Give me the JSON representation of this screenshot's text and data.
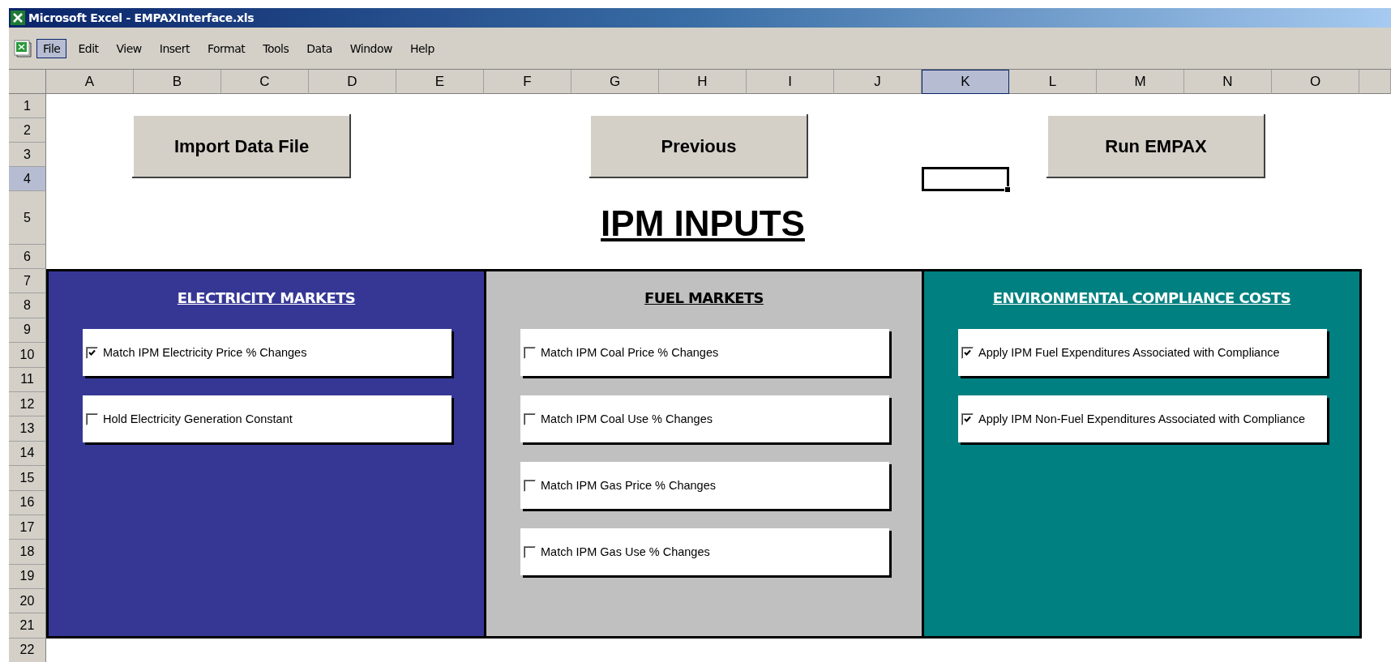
{
  "window": {
    "title": "Microsoft Excel - EMPAXInterface.xls"
  },
  "menu": [
    {
      "label": "File",
      "selected": true
    },
    {
      "label": "Edit",
      "selected": false
    },
    {
      "label": "View",
      "selected": false
    },
    {
      "label": "Insert",
      "selected": false
    },
    {
      "label": "Format",
      "selected": false
    },
    {
      "label": "Tools",
      "selected": false
    },
    {
      "label": "Data",
      "selected": false
    },
    {
      "label": "Window",
      "selected": false
    },
    {
      "label": "Help",
      "selected": false
    }
  ],
  "columns": [
    {
      "label": "A",
      "selected": false
    },
    {
      "label": "B",
      "selected": false
    },
    {
      "label": "C",
      "selected": false
    },
    {
      "label": "D",
      "selected": false
    },
    {
      "label": "E",
      "selected": false
    },
    {
      "label": "F",
      "selected": false
    },
    {
      "label": "G",
      "selected": false
    },
    {
      "label": "H",
      "selected": false
    },
    {
      "label": "I",
      "selected": false
    },
    {
      "label": "J",
      "selected": false
    },
    {
      "label": "K",
      "selected": true
    },
    {
      "label": "L",
      "selected": false
    },
    {
      "label": "M",
      "selected": false
    },
    {
      "label": "N",
      "selected": false
    },
    {
      "label": "O",
      "selected": false
    }
  ],
  "rows": [
    {
      "label": "1",
      "selected": false
    },
    {
      "label": "2",
      "selected": false
    },
    {
      "label": "3",
      "selected": false
    },
    {
      "label": "4",
      "selected": true
    },
    {
      "label": "5",
      "selected": false
    },
    {
      "label": "6",
      "selected": false
    },
    {
      "label": "7",
      "selected": false
    },
    {
      "label": "8",
      "selected": false
    },
    {
      "label": "9",
      "selected": false
    },
    {
      "label": "10",
      "selected": false
    },
    {
      "label": "11",
      "selected": false
    },
    {
      "label": "12",
      "selected": false
    },
    {
      "label": "13",
      "selected": false
    },
    {
      "label": "14",
      "selected": false
    },
    {
      "label": "15",
      "selected": false
    },
    {
      "label": "16",
      "selected": false
    },
    {
      "label": "17",
      "selected": false
    },
    {
      "label": "18",
      "selected": false
    },
    {
      "label": "19",
      "selected": false
    },
    {
      "label": "20",
      "selected": false
    },
    {
      "label": "21",
      "selected": false
    },
    {
      "label": "22",
      "selected": false
    }
  ],
  "buttons": [
    "Import Data File",
    "Previous",
    "Run EMPAX"
  ],
  "heading": "IPM INPUTS",
  "panels": [
    {
      "title": "ELECTRICITY MARKETS",
      "color": "#363795",
      "options": [
        {
          "label": "Match IPM Electricity Price % Changes",
          "checked": true
        },
        {
          "label": "Hold Electricity Generation Constant",
          "checked": false
        }
      ]
    },
    {
      "title": "FUEL MARKETS",
      "color": "#c0c0c0",
      "options": [
        {
          "label": "Match IPM Coal Price % Changes",
          "checked": false
        },
        {
          "label": "Match IPM Coal Use % Changes",
          "checked": false
        },
        {
          "label": "Match IPM Gas Price % Changes",
          "checked": false
        },
        {
          "label": "Match IPM Gas Use % Changes",
          "checked": false
        }
      ]
    },
    {
      "title": "ENVIRONMENTAL COMPLIANCE COSTS",
      "color": "#008080",
      "options": [
        {
          "label": "Apply IPM Fuel Expenditures Associated with Compliance",
          "checked": true
        },
        {
          "label": "Apply IPM Non-Fuel Expenditures Associated with Compliance",
          "checked": true
        }
      ]
    }
  ]
}
